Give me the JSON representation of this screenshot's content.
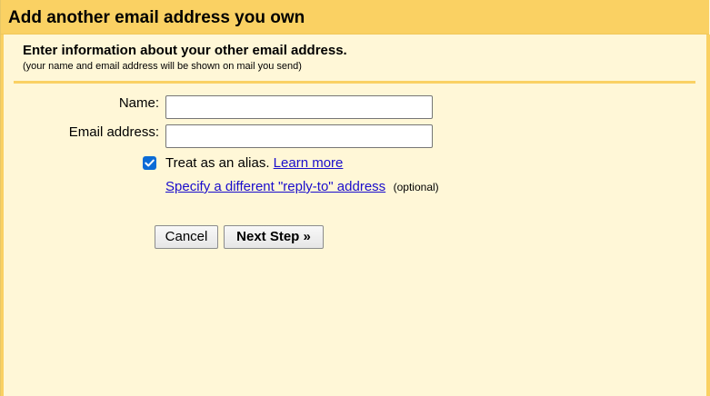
{
  "dialog": {
    "title": "Add another email address you own",
    "heading": "Enter information about your other email address.",
    "subheading": "(your name and email address will be shown on mail you send)"
  },
  "form": {
    "name_label": "Name:",
    "name_value": "",
    "email_label": "Email address:",
    "email_value": "",
    "alias_checked": true,
    "alias_label": "Treat as an alias.",
    "learn_more_link": "Learn more",
    "reply_to_link": "Specify a different \"reply-to\" address",
    "reply_to_optional": "(optional)"
  },
  "buttons": {
    "cancel_label": "Cancel",
    "next_label": "Next Step »"
  },
  "colors": {
    "title_bar": "#fad163",
    "panel_background": "#fff7d7",
    "link": "#1a0dcc",
    "checkbox": "#0b6bd6"
  },
  "icons": {
    "checkbox": "checkmark-icon"
  }
}
